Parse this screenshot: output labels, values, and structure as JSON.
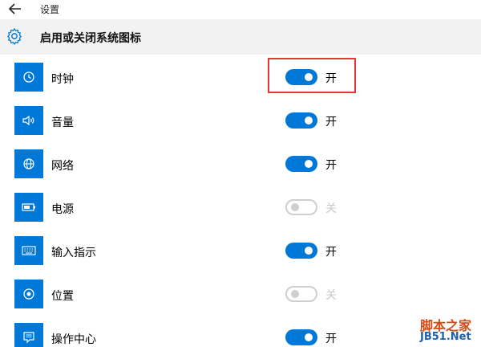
{
  "window": {
    "title": "设置"
  },
  "header": {
    "title": "启用或关闭系统图标",
    "icon": "gear-icon"
  },
  "colors": {
    "accent": "#0078d7",
    "highlight": "#e53935",
    "off": "#c8c8c8"
  },
  "items": [
    {
      "label": "时钟",
      "icon": "clock-icon",
      "state": "开",
      "on": true
    },
    {
      "label": "音量",
      "icon": "volume-icon",
      "state": "开",
      "on": true
    },
    {
      "label": "网络",
      "icon": "network-icon",
      "state": "开",
      "on": true
    },
    {
      "label": "电源",
      "icon": "battery-icon",
      "state": "关",
      "on": false
    },
    {
      "label": "输入指示",
      "icon": "keyboard-icon",
      "state": "开",
      "on": true
    },
    {
      "label": "位置",
      "icon": "location-icon",
      "state": "关",
      "on": false
    },
    {
      "label": "操作中心",
      "icon": "action-center-icon",
      "state": "开",
      "on": true
    }
  ],
  "watermark": {
    "line1": "脚本之家",
    "line2": "JB51.Net"
  }
}
